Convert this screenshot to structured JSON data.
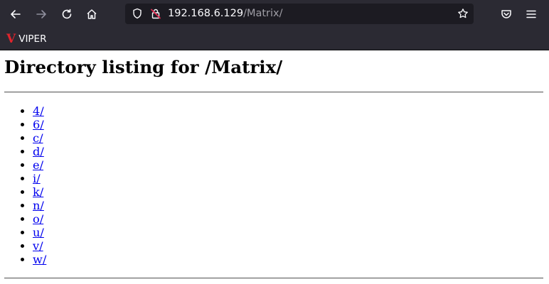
{
  "browser": {
    "url": {
      "host": "192.168.6.129",
      "path": "/Matrix/"
    },
    "bookmark": {
      "logo": "V",
      "label": "VIPER"
    }
  },
  "page": {
    "heading": "Directory listing for /Matrix/",
    "entries": [
      "4/",
      "6/",
      "c/",
      "d/",
      "e/",
      "i/",
      "k/",
      "n/",
      "o/",
      "u/",
      "v/",
      "w/"
    ]
  },
  "colors": {
    "toolbar": "#2b2a33",
    "urlbar": "#1c1b22",
    "link": "#0000ee",
    "viper": "#e0242c"
  }
}
